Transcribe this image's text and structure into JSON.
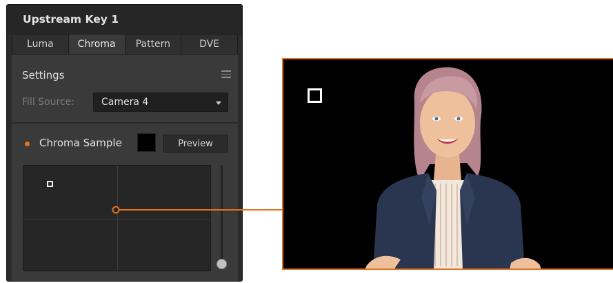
{
  "panel": {
    "title": "Upstream Key 1",
    "tabs": [
      "Luma",
      "Chroma",
      "Pattern",
      "DVE"
    ],
    "active_tab": "Chroma",
    "settings": {
      "title": "Settings",
      "fill_source_label": "Fill Source:",
      "fill_source_value": "Camera 4"
    },
    "chroma_sample": {
      "label": "Chroma Sample",
      "swatch_color": "#000000",
      "preview_label": "Preview"
    }
  },
  "colors": {
    "accent": "#e2721e",
    "panel_bg": "#2b2b2b",
    "section_bg": "#3a3a3a"
  },
  "icons": [
    "menu-icon",
    "chevron-down-icon",
    "indicator-dot"
  ]
}
